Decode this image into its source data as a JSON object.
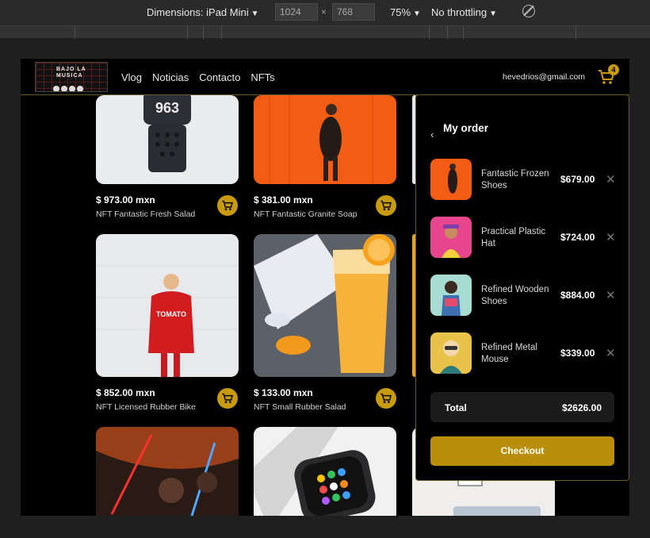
{
  "devtools": {
    "device_label": "Dimensions: iPad Mini",
    "width": "1024",
    "height": "768",
    "times": "×",
    "zoom": "75%",
    "throttling": "No throttling"
  },
  "header": {
    "logo_text": "BAJO LA MUSICA",
    "nav": [
      "Vlog",
      "Noticias",
      "Contacto",
      "NFTs"
    ],
    "email": "hevedrios@gmail.com",
    "cart_count": "4"
  },
  "products": [
    {
      "price": "$ 973.00 mxn",
      "name": "NFT Fantastic Fresh Salad",
      "image": "smartwatch-photo"
    },
    {
      "price": "$ 381.00 mxn",
      "name": "NFT Fantastic Granite Soap",
      "image": "woman-orange-wall-photo"
    },
    {
      "price": "$ 852.00 mxn",
      "name": "NFT Licensed Rubber Bike",
      "image": "woman-red-sweater-photo"
    },
    {
      "price": "$ 133.00 mxn",
      "name": "NFT Small Rubber Salad",
      "image": "orange-juice-photo"
    },
    {
      "image": "star-wars-poster-photo"
    },
    {
      "image": "apple-watch-photo"
    }
  ],
  "order": {
    "title": "My order",
    "back_icon": "chevron-left-icon",
    "items": [
      {
        "name": "Fantastic Frozen Shoes",
        "price": "$679.00"
      },
      {
        "name": "Practical Plastic Hat",
        "price": "$724.00"
      },
      {
        "name": "Refined Wooden Shoes",
        "price": "$884.00"
      },
      {
        "name": "Refined Metal Mouse",
        "price": "$339.00"
      }
    ],
    "remove_glyph": "✕",
    "total_label": "Total",
    "total_value": "$2626.00",
    "checkout_label": "Checkout"
  },
  "colors": {
    "accent": "#c89b0c",
    "checkout": "#b98e0a",
    "background": "#000000",
    "panel_border": "#6b5a1e"
  }
}
